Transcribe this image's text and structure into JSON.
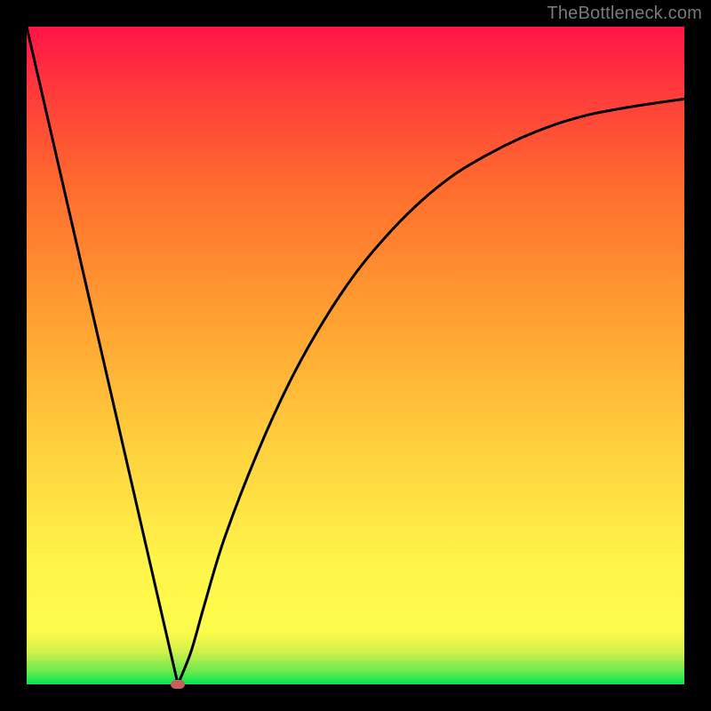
{
  "watermark": "TheBottleneck.com",
  "chart_data": {
    "type": "line",
    "title": "",
    "xlabel": "",
    "ylabel": "",
    "xlim": [
      0,
      100
    ],
    "ylim": [
      0,
      100
    ],
    "grid": false,
    "legend": false,
    "series": [
      {
        "name": "bottleneck-curve",
        "x": [
          0,
          5,
          10,
          15,
          20,
          23,
          25,
          27,
          30,
          35,
          40,
          45,
          50,
          55,
          60,
          65,
          70,
          75,
          80,
          85,
          90,
          95,
          100
        ],
        "values": [
          100,
          78.3,
          56.5,
          34.8,
          13.0,
          0.0,
          5.0,
          12.0,
          22.0,
          35.0,
          46.0,
          55.0,
          62.5,
          68.5,
          73.5,
          77.5,
          80.5,
          83.0,
          85.0,
          86.5,
          87.5,
          88.3,
          89.0
        ]
      }
    ],
    "minimum_marker": {
      "x": 23,
      "value": 0,
      "color": "#c7625b"
    },
    "background_gradient": {
      "stops": [
        {
          "offset": 0.0,
          "color": "#00e651"
        },
        {
          "offset": 0.02,
          "color": "#6cea4f"
        },
        {
          "offset": 0.05,
          "color": "#d2f04c"
        },
        {
          "offset": 0.08,
          "color": "#fcfb4b"
        },
        {
          "offset": 0.18,
          "color": "#fff54a"
        },
        {
          "offset": 0.35,
          "color": "#ffd33e"
        },
        {
          "offset": 0.55,
          "color": "#ffa232"
        },
        {
          "offset": 0.75,
          "color": "#ff6e2e"
        },
        {
          "offset": 0.9,
          "color": "#ff3b3b"
        },
        {
          "offset": 1.0,
          "color": "#ff1446"
        }
      ]
    }
  }
}
